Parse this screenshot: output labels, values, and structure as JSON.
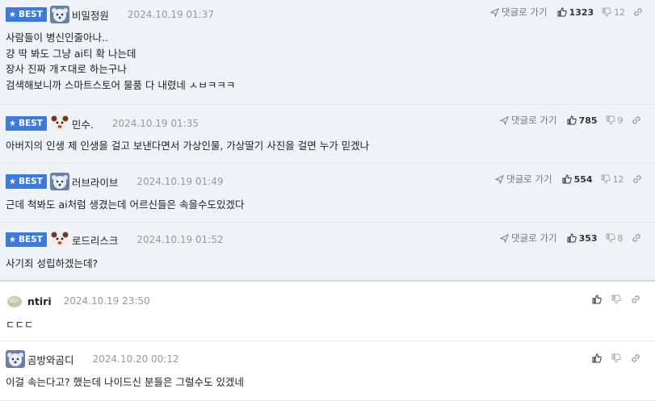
{
  "best_badge": "BEST",
  "reply_label": "댓글로 가기",
  "comments": [
    {
      "nickname": "비밀정원",
      "date": "2024.10.19 01:37",
      "upvotes": "1323",
      "downvotes": "12",
      "lines": [
        "사람들이 병신인줄아나..",
        "걍 딱 봐도 그냥 ai티 확 나는데",
        "장사 진짜 개ㅈ대로 하는구나",
        "검색해보니까 스마트스토어 물품 다 내렸네 ㅅㅂㅋㅋㅋ"
      ]
    },
    {
      "nickname": "민수.",
      "date": "2024.10.19 01:35",
      "upvotes": "785",
      "downvotes": "9",
      "lines": [
        "아버지의 인생 제 인생을 걸고 보낸다면서 가상인물, 가상딸기 사진을 걸면 누가 믿겠나"
      ]
    },
    {
      "nickname": "러브라이브",
      "date": "2024.10.19 01:49",
      "upvotes": "554",
      "downvotes": "12",
      "lines": [
        "근데 척봐도 ai처럼 생겼는데 어르신들은 속을수도있겠다"
      ]
    },
    {
      "nickname": "로드리스크",
      "date": "2024.10.19 01:52",
      "upvotes": "353",
      "downvotes": "8",
      "lines": [
        "사기죄 성립하겠는데?"
      ]
    },
    {
      "nickname": "ntiri",
      "date": "2024.10.19 23:50",
      "lines": [
        "ㄷㄷㄷ"
      ]
    },
    {
      "nickname": "곰방와곰디",
      "date": "2024.10.20 00:12",
      "lines": [
        "이걸 속는다고? 했는데 나이드신 분들은 그럴수도 있겠네"
      ]
    }
  ]
}
